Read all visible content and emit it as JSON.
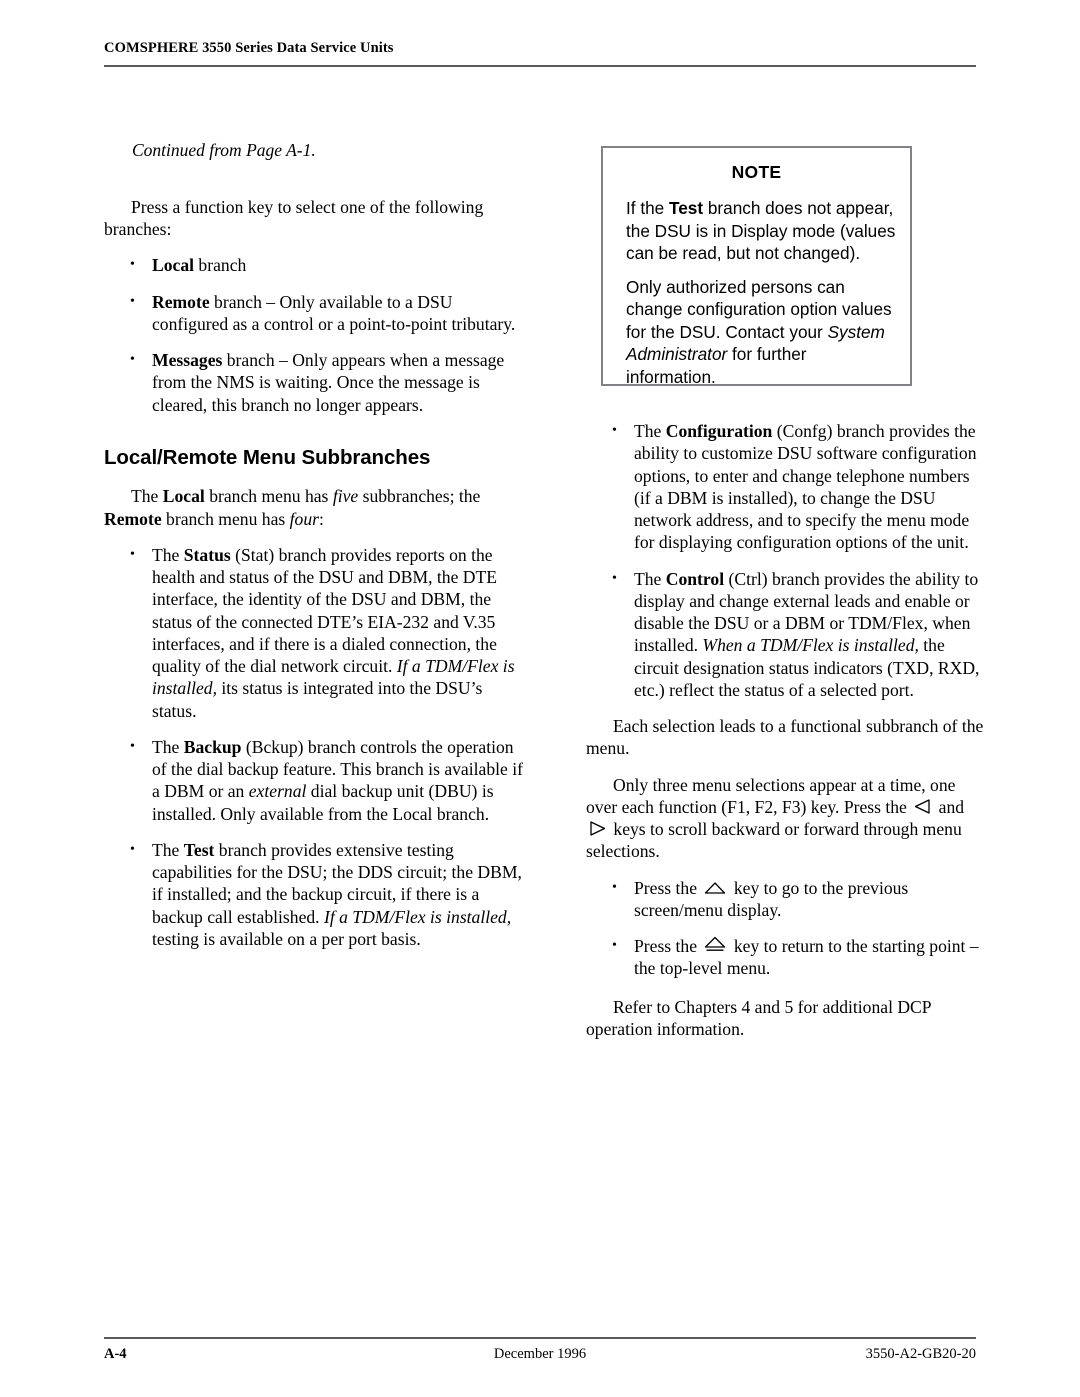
{
  "header": {
    "title": "COMSPHERE 3550 Series Data Service Units"
  },
  "left_column": {
    "continued_note": "Continued from Page A-1.",
    "intro_paragraph": "Press a function key to select one of the following branches:",
    "branch_bullets": [
      {
        "bold_lead": "Local",
        "rest": " branch"
      },
      {
        "bold_lead": "Remote",
        "rest": " branch – Only available to a DSU configured as a control or a point-to-point tributary."
      },
      {
        "bold_lead": "Messages",
        "rest": " branch – Only appears when a message from the NMS is waiting. Once the message is cleared, this branch no longer appears."
      }
    ],
    "section_heading": "Local/Remote Menu Subbranches",
    "subbranch_intro": {
      "part1": "The ",
      "bold1": "Local",
      "part2": " branch menu has ",
      "italic1": "five",
      "part3": " subbranches; the ",
      "bold2": "Remote",
      "part4": " branch menu has ",
      "italic2": "four",
      "part5": ":"
    },
    "subbranch_bullets": [
      {
        "lead": "The ",
        "bold": "Status",
        "mid": " (Stat) branch provides reports on the health and status of the DSU and DBM, the DTE interface, the identity of the DSU and DBM, the status of the connected DTE’s EIA-232 and V.35 interfaces, and if there is a dialed connection, the quality of the dial network circuit. ",
        "italic": "If a TDM/Flex is installed,",
        "tail": " its status is integrated into the DSU’s status."
      },
      {
        "lead": "The ",
        "bold": "Backup",
        "mid": " (Bckup) branch controls the operation of the dial backup feature. This branch is available if a DBM or an ",
        "italic": "external",
        "tail": " dial backup unit (DBU) is installed. Only available from the Local branch."
      },
      {
        "lead": "The ",
        "bold": "Test",
        "mid": " branch provides extensive testing capabilities for the DSU; the DDS circuit; the DBM, if installed; and the backup circuit, if there is a backup call established. ",
        "italic": "If a TDM/Flex is installed,",
        "tail": " testing is available on a per port basis."
      }
    ]
  },
  "note_box": {
    "title": "NOTE",
    "paragraph1": {
      "part1": "If the ",
      "bold": "Test",
      "part2": " branch does not appear, the DSU is in Display mode (values can be read, but not changed)."
    },
    "paragraph2": {
      "part1": "Only authorized persons can change configuration option values for the DSU. Contact your ",
      "italic": "System Administrator",
      "part2": " for further information."
    }
  },
  "right_column": {
    "menu_bullets": [
      {
        "lead": "The ",
        "bold": "Configuration",
        "mid": " (Confg) branch provides the ability to customize DSU software configuration options, to enter and change telephone numbers (if a DBM is installed), to change the DSU network address, and to specify the menu mode for displaying configuration options of the unit.",
        "italic": "",
        "tail": ""
      },
      {
        "lead": "The ",
        "bold": "Control",
        "mid": " (Ctrl) branch provides the ability to display and change external leads and enable or disable the DSU or a DBM or TDM/Flex, when installed. ",
        "italic": "When a TDM/Flex is installed,",
        "tail": " the circuit designation status indicators (TXD, RXD, etc.) reflect the status of a selected port."
      }
    ],
    "paragraph_each_selection": "Each selection leads to a functional subbranch of the menu.",
    "paragraph_scroll": {
      "part1": "Only three menu selections appear at a time, one over each function (F1, F2, F3) key. Press the ",
      "icon_left": "left-arrow-key-icon",
      "part2": " and ",
      "icon_right": "right-arrow-key-icon",
      "part3": " keys to scroll backward or forward through menu selections."
    },
    "key_bullets": [
      {
        "part1": "Press the ",
        "icon": "up-arrow-key-icon",
        "part2": " key to go to the previous screen/menu display."
      },
      {
        "part1": "Press the ",
        "icon": "home-arrow-key-icon",
        "part2": " key to return to the starting point – the top-level menu."
      }
    ],
    "paragraph_refer": "Refer to Chapters 4 and 5 for additional DCP operation information."
  },
  "footer": {
    "page_number": "A-4",
    "date": "December 1996",
    "document_number": "3550-A2-GB20-20"
  },
  "bullet_glyph": "•",
  "colors": {
    "rule": "#59595b",
    "note_border": "#808285",
    "text": "#000000"
  }
}
